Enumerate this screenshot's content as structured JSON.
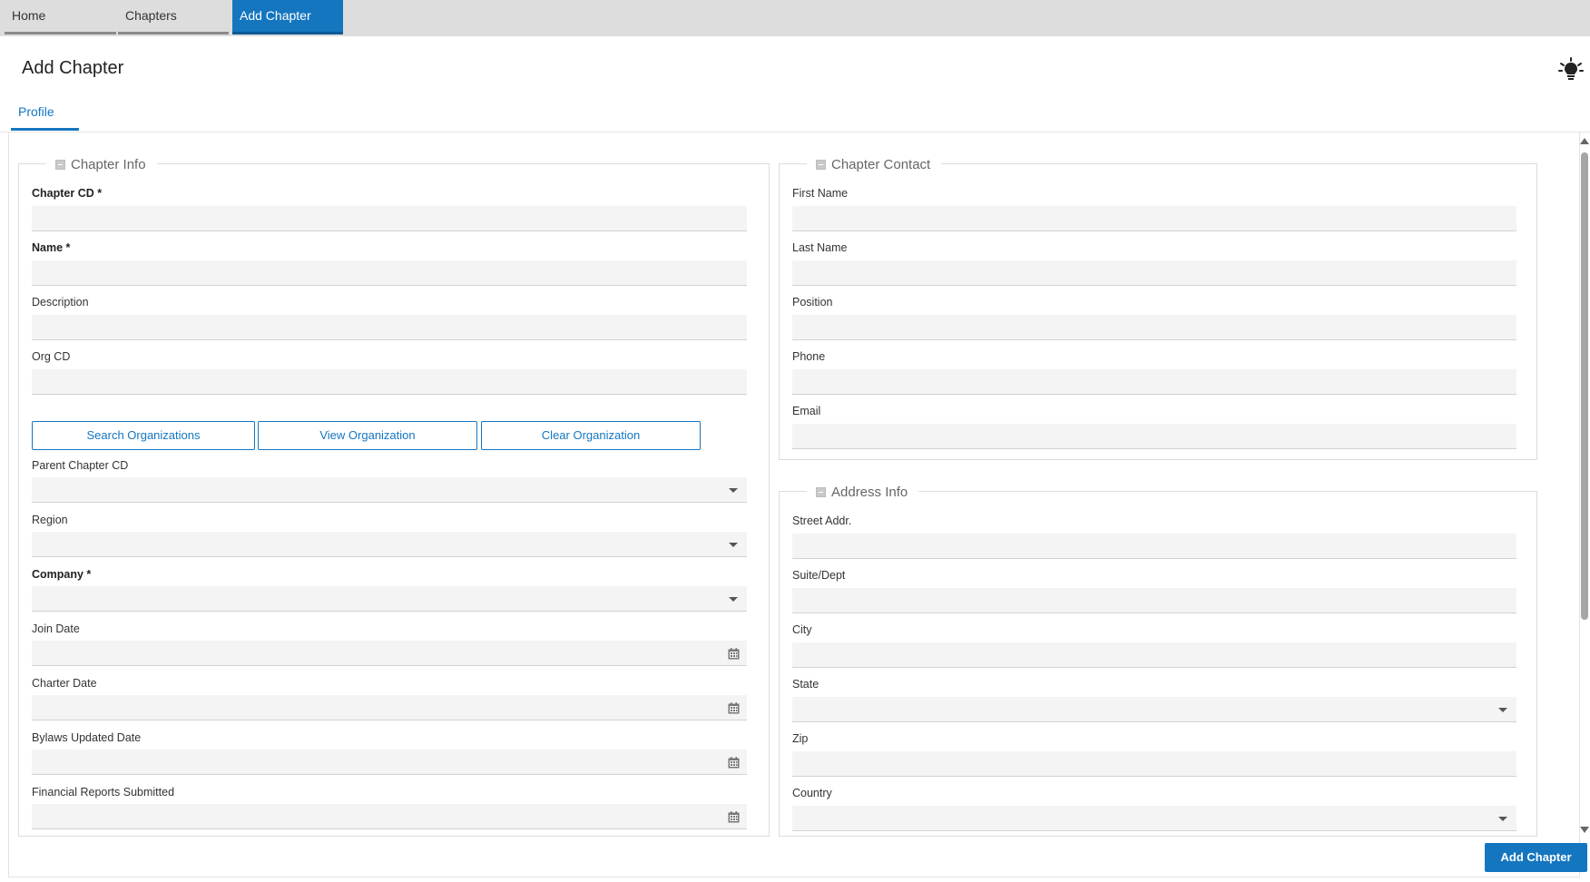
{
  "top_tabs": [
    {
      "label": "Home",
      "active": false
    },
    {
      "label": "Chapters",
      "active": false
    },
    {
      "label": "Add Chapter",
      "active": true
    }
  ],
  "page": {
    "title": "Add Chapter",
    "help_icon": "lightbulb-icon"
  },
  "sub_tabs": [
    {
      "label": "Profile",
      "active": true
    }
  ],
  "chapter_info": {
    "legend": "Chapter Info",
    "chapter_cd_label": "Chapter CD *",
    "name_label": "Name *",
    "description_label": "Description",
    "org_cd_label": "Org CD",
    "search_org_button": "Search Organizations",
    "view_org_button": "View Organization",
    "clear_org_button": "Clear Organization",
    "parent_chapter_label": "Parent Chapter CD",
    "region_label": "Region",
    "company_label": "Company *",
    "join_date_label": "Join Date",
    "charter_date_label": "Charter Date",
    "bylaws_date_label": "Bylaws Updated Date",
    "financial_reports_label": "Financial Reports Submitted"
  },
  "chapter_contact": {
    "legend": "Chapter Contact",
    "first_name_label": "First Name",
    "last_name_label": "Last Name",
    "position_label": "Position",
    "phone_label": "Phone",
    "email_label": "Email"
  },
  "address_info": {
    "legend": "Address Info",
    "street_label": "Street Addr.",
    "suite_label": "Suite/Dept",
    "city_label": "City",
    "state_label": "State",
    "zip_label": "Zip",
    "country_label": "Country"
  },
  "footer": {
    "add_button": "Add Chapter"
  },
  "colors": {
    "accent": "#1576c0",
    "topbar": "#dddddd",
    "input_bg": "#f4f4f4"
  }
}
